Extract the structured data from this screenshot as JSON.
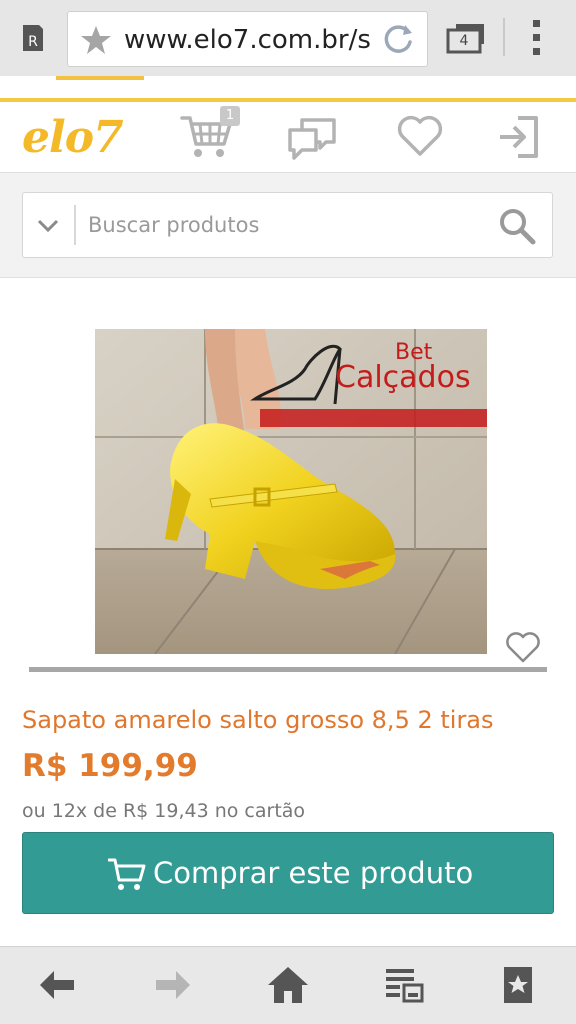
{
  "browser": {
    "url": "www.elo7.com.br/s",
    "tab_count": "4",
    "favicon_letter": "R"
  },
  "site": {
    "logo": "elo7",
    "cart_count": "1",
    "brand_color": "#f4b928",
    "icons": [
      "cart-icon",
      "chat-icon",
      "heart-icon",
      "login-icon"
    ]
  },
  "search": {
    "placeholder": "Buscar produtos",
    "value": ""
  },
  "product": {
    "image_overlay": {
      "brand_top": "Bet",
      "brand_main": "Calçados"
    },
    "title": "Sapato amarelo salto grosso 8,5 2 tiras",
    "price": "R$ 199,99",
    "installments": "ou 12x de R$ 19,43 no cartão",
    "buy_label": "Comprar este produto",
    "accent_color": "#329b94",
    "price_color": "#e37b2d"
  },
  "bottom_nav": {
    "icons": [
      "back-arrow-icon",
      "forward-arrow-icon",
      "home-icon",
      "reader-icon",
      "bookmarks-icon"
    ]
  }
}
